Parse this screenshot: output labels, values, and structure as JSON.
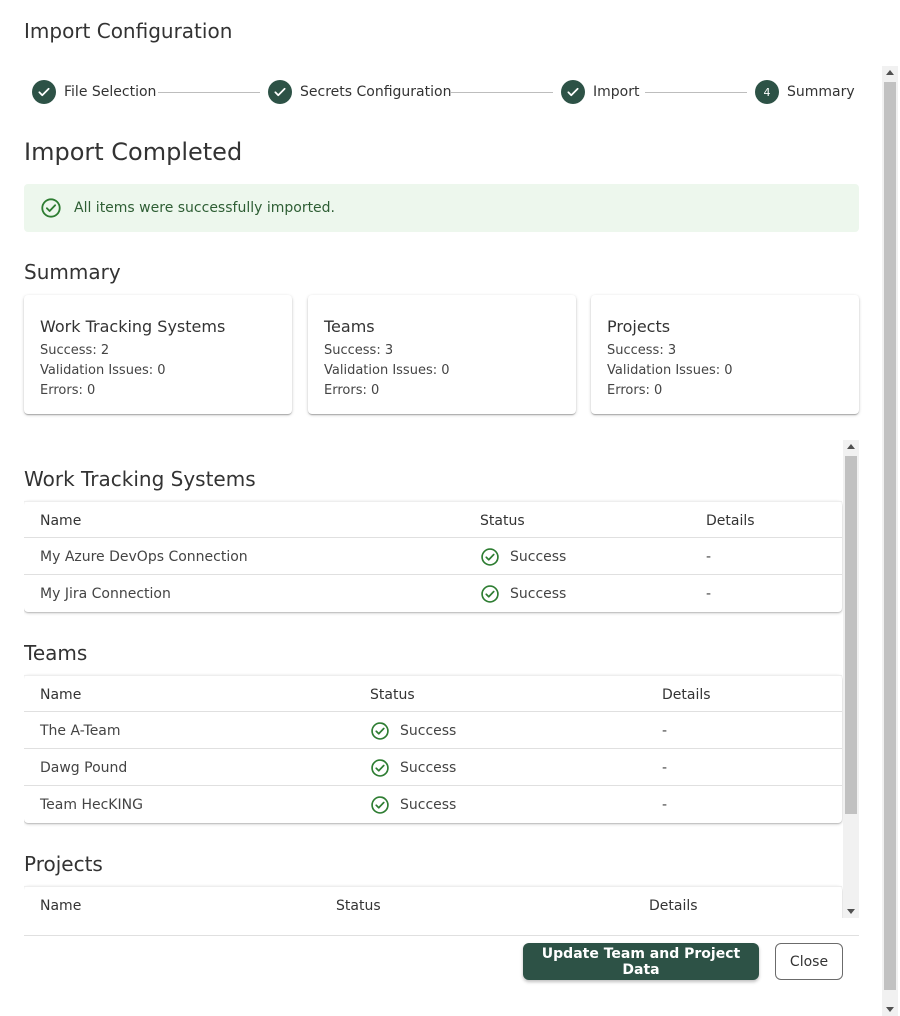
{
  "dialog": {
    "title": "Import Configuration"
  },
  "stepper": {
    "steps": [
      {
        "label": "File Selection",
        "state": "done"
      },
      {
        "label": "Secrets Configuration",
        "state": "done"
      },
      {
        "label": "Import",
        "state": "done"
      },
      {
        "label": "Summary",
        "state": "active",
        "number": "4"
      }
    ]
  },
  "result": {
    "heading": "Import Completed",
    "alert": "All items were successfully imported.",
    "alert_icon": "check-circle-outline-icon"
  },
  "summary": {
    "heading": "Summary",
    "cards": [
      {
        "title": "Work Tracking Systems",
        "success": "Success: 2",
        "validation": "Validation Issues: 0",
        "errors": "Errors: 0"
      },
      {
        "title": "Teams",
        "success": "Success: 3",
        "validation": "Validation Issues: 0",
        "errors": "Errors: 0"
      },
      {
        "title": "Projects",
        "success": "Success: 3",
        "validation": "Validation Issues: 0",
        "errors": "Errors: 0"
      }
    ]
  },
  "tables": {
    "columns": {
      "name": "Name",
      "status": "Status",
      "details": "Details"
    },
    "wts": {
      "heading": "Work Tracking Systems",
      "rows": [
        {
          "name": "My Azure DevOps Connection",
          "status": "Success",
          "details": "-"
        },
        {
          "name": "My Jira Connection",
          "status": "Success",
          "details": "-"
        }
      ]
    },
    "teams": {
      "heading": "Teams",
      "rows": [
        {
          "name": "The A-Team",
          "status": "Success",
          "details": "-"
        },
        {
          "name": "Dawg Pound",
          "status": "Success",
          "details": "-"
        },
        {
          "name": "Team HecKING",
          "status": "Success",
          "details": "-"
        }
      ]
    },
    "projects": {
      "heading": "Projects",
      "rows": []
    }
  },
  "actions": {
    "update_label": "Update Team and Project Data",
    "close_label": "Close"
  },
  "colors": {
    "primary": "#2d5246",
    "success_bg": "#edf7ed",
    "success_icon": "#2e7d32"
  }
}
